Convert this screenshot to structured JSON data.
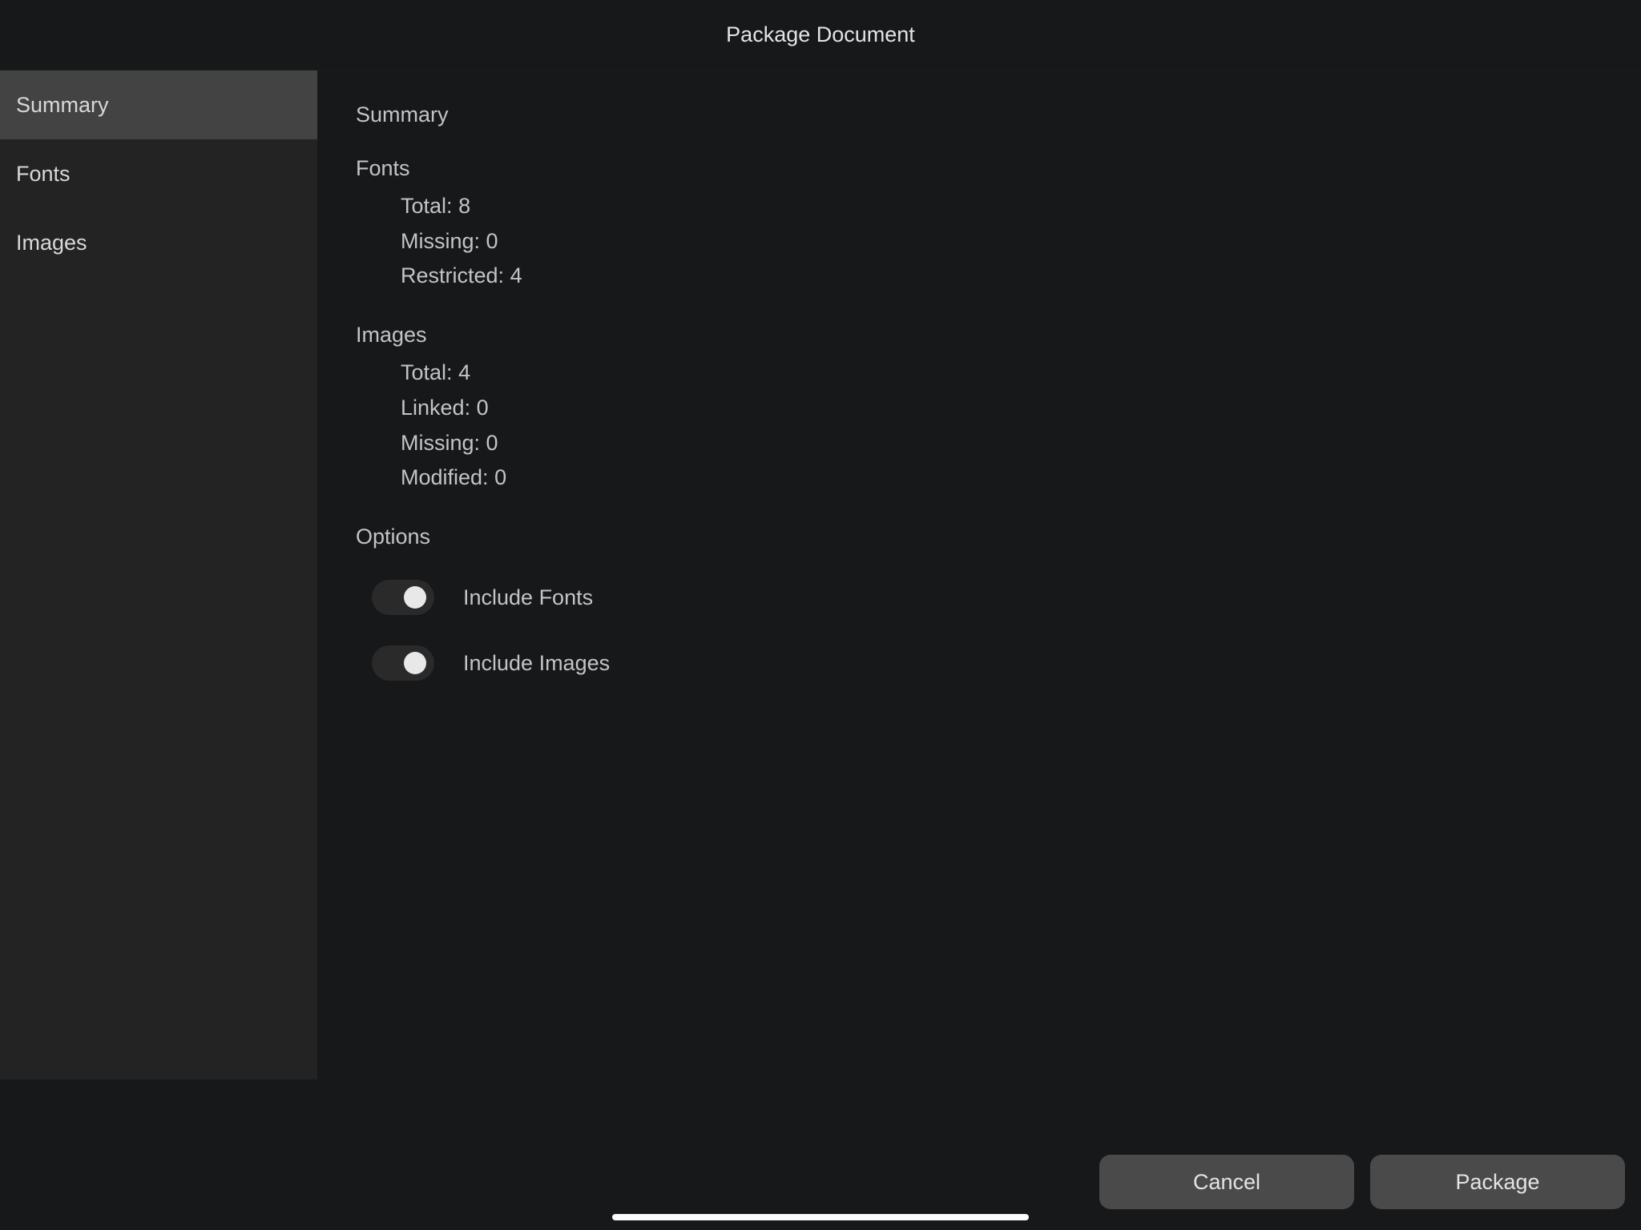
{
  "header": {
    "title": "Package Document"
  },
  "sidebar": {
    "items": [
      {
        "label": "Summary",
        "active": true
      },
      {
        "label": "Fonts",
        "active": false
      },
      {
        "label": "Images",
        "active": false
      }
    ]
  },
  "main": {
    "section_title": "Summary",
    "fonts": {
      "heading": "Fonts",
      "total_label": "Total:",
      "total": 8,
      "missing_label": "Missing:",
      "missing": 0,
      "restricted_label": "Restricted:",
      "restricted": 4
    },
    "images": {
      "heading": "Images",
      "total_label": "Total:",
      "total": 4,
      "linked_label": "Linked:",
      "linked": 0,
      "missing_label": "Missing:",
      "missing": 0,
      "modified_label": "Modified:",
      "modified": 0
    },
    "options": {
      "heading": "Options",
      "include_fonts_label": "Include Fonts",
      "include_fonts_on": true,
      "include_images_label": "Include Images",
      "include_images_on": true
    }
  },
  "footer": {
    "cancel_label": "Cancel",
    "package_label": "Package"
  }
}
